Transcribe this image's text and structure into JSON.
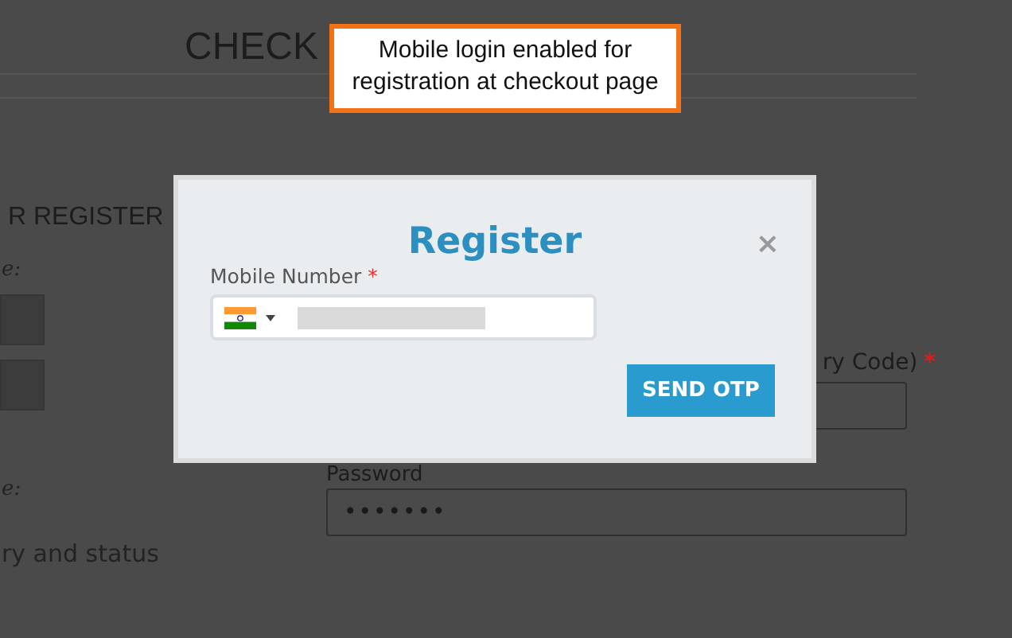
{
  "page": {
    "title": "CHECK",
    "left_heading": "R REGISTER",
    "left_label_1": "e:",
    "left_label_2": "e:",
    "left_text": "ry and status",
    "right_label": "ry Code)",
    "right_required": "*",
    "password_label": "Password",
    "password_value": "•••••••"
  },
  "callout": {
    "text": "Mobile login enabled for registration at checkout page"
  },
  "modal": {
    "title": "Register",
    "close": "×",
    "field": {
      "label": "Mobile Number",
      "required": "*",
      "redacted": true
    },
    "button": "SEND OTP"
  }
}
